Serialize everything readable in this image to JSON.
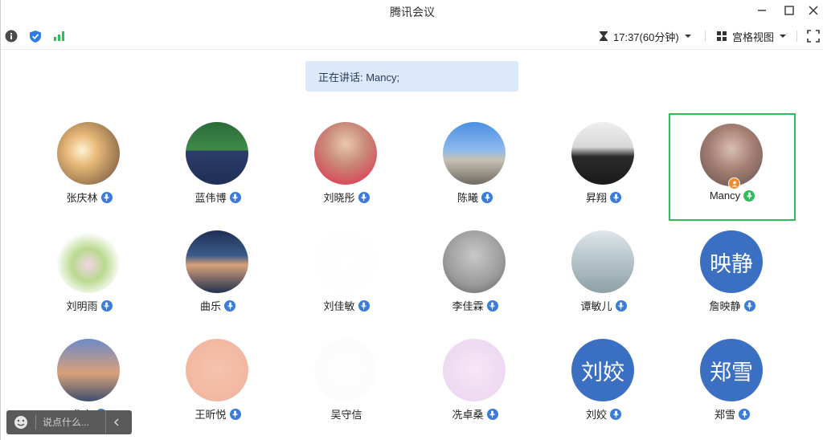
{
  "window": {
    "title": "腾讯会议"
  },
  "toolbar": {
    "timer": "17:37(60分钟)",
    "view_label": "宫格视图"
  },
  "speaking": {
    "text": "正在讲话: Mancy;"
  },
  "colors": {
    "accent": "#3b7bdc",
    "active_border": "#2dbd5a",
    "host_badge": "#f08a2a",
    "banner_bg": "#dce9fb"
  },
  "participants": [
    {
      "name": "张庆林",
      "avatar_text": "",
      "mic": "muted"
    },
    {
      "name": "蓝伟博",
      "avatar_text": "",
      "mic": "muted"
    },
    {
      "name": "刘晓彤",
      "avatar_text": "",
      "mic": "muted"
    },
    {
      "name": "陈曦",
      "avatar_text": "",
      "mic": "muted"
    },
    {
      "name": "昇翔",
      "avatar_text": "",
      "mic": "muted"
    },
    {
      "name": "Mancy",
      "avatar_text": "",
      "mic": "speaking",
      "host": true,
      "active": true
    },
    {
      "name": "刘明雨",
      "avatar_text": "",
      "mic": "muted"
    },
    {
      "name": "曲乐",
      "avatar_text": "",
      "mic": "muted"
    },
    {
      "name": "刘佳敏",
      "avatar_text": "",
      "mic": "muted"
    },
    {
      "name": "李佳霖",
      "avatar_text": "",
      "mic": "muted"
    },
    {
      "name": "谭敏儿",
      "avatar_text": "",
      "mic": "muted"
    },
    {
      "name": "詹映静",
      "avatar_text": "映静",
      "mic": "muted"
    },
    {
      "name": "戈方",
      "avatar_text": "",
      "mic": "muted"
    },
    {
      "name": "王昕悦",
      "avatar_text": "",
      "mic": "muted"
    },
    {
      "name": "吴守信",
      "avatar_text": "",
      "mic": "none"
    },
    {
      "name": "冼卓桑",
      "avatar_text": "",
      "mic": "muted"
    },
    {
      "name": "刘姣",
      "avatar_text": "刘姣",
      "mic": "muted"
    },
    {
      "name": "郑雪",
      "avatar_text": "郑雪",
      "mic": "muted"
    }
  ],
  "chat": {
    "placeholder": "说点什么..."
  }
}
